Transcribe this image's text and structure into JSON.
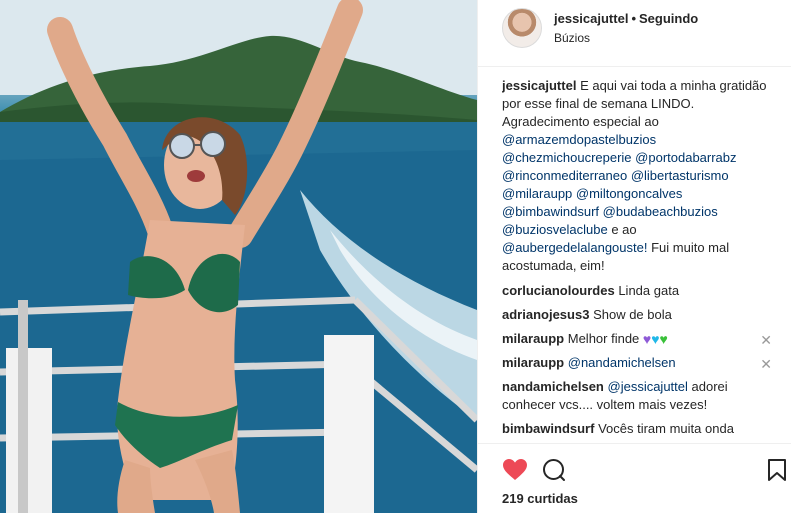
{
  "post": {
    "photo_alt": "",
    "header": {
      "username": "jessicajuttel",
      "separator": "•",
      "follow_status": "Seguindo",
      "location": "Búzios"
    },
    "caption": {
      "username": "jessicajuttel",
      "text_1": "E aqui vai toda a minha gratidão por esse final de semana LINDO. Agradecimento especial ao",
      "mentions_a": [
        "@armazemdopastelbuzios",
        "@chezmichoucreperie",
        "@portodabarrabz",
        "@rinconmediterraneo",
        "@libertasturismo",
        "@milaraupp",
        "@miltongoncalves",
        "@bimbawindsurf",
        "@budabeachbuzios",
        "@buziosvelaclube"
      ],
      "text_2": "e ao",
      "mention_last": "@aubergedelalangouste!",
      "text_3": "Fui muito mal acostumada, eim!"
    },
    "comments": [
      {
        "username": "corlucianolourdes",
        "text": "Linda gata"
      },
      {
        "username": "adrianojesus3",
        "text": "Show de bola"
      },
      {
        "username": "milaraupp",
        "text": "Melhor finde",
        "hearts": [
          "#8e5ad7",
          "#21b8e8",
          "#3ac13a"
        ],
        "close_icon": "close-icon"
      },
      {
        "username": "milaraupp",
        "mention": "@nandamichelsen",
        "close_icon": "close-icon"
      },
      {
        "username": "nandamichelsen",
        "mention": "@jessicajuttel",
        "text": "adorei conhecer vcs.... voltem mais vezes!"
      },
      {
        "username": "bimbawindsurf",
        "text": "Vocês tiram muita onda"
      }
    ],
    "likes_count": "219 curtidas",
    "icons": {
      "like": "heart-icon",
      "comment": "comment-icon",
      "save": "bookmark-icon"
    },
    "colors": {
      "like_red": "#ed4956",
      "mention_blue": "#003569",
      "border": "#efefef"
    }
  }
}
